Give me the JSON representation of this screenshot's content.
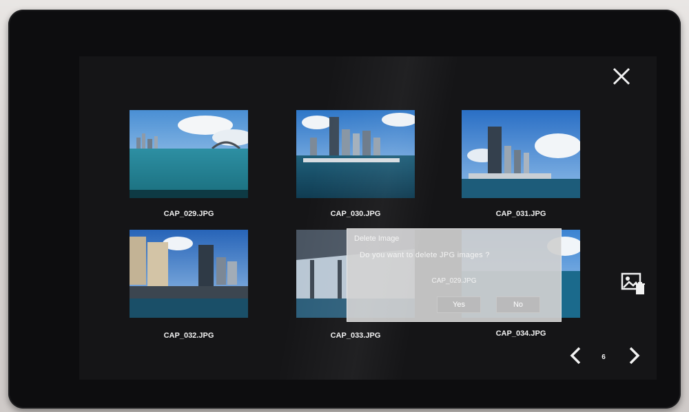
{
  "gallery": {
    "page_number": "6",
    "thumbnails": [
      {
        "name": "CAP_029.JPG"
      },
      {
        "name": "CAP_030.JPG"
      },
      {
        "name": "CAP_031.JPG"
      },
      {
        "name": "CAP_032.JPG"
      },
      {
        "name": "CAP_033.JPG"
      },
      {
        "name": "CAP_034.JPG"
      }
    ]
  },
  "dialog": {
    "title": "Delete Image",
    "message": "Do you want to delete JPG images ?",
    "file": "CAP_029.JPG",
    "yes_label": "Yes",
    "no_label": "No"
  },
  "icons": {
    "close": "close-icon",
    "delete_image": "image-delete-icon",
    "prev": "chevron-left-icon",
    "next": "chevron-right-icon"
  },
  "colors": {
    "screen_bg": "#151517",
    "dialog_bg": "#d0d0d0",
    "text": "#f1f1f1"
  }
}
